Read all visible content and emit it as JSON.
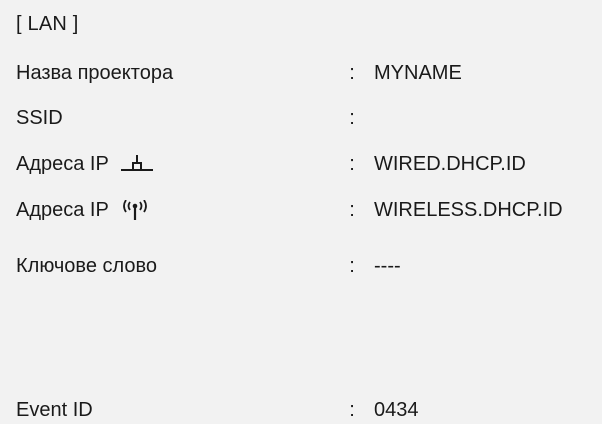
{
  "header": {
    "title": "[ LAN ]"
  },
  "rows": [
    {
      "label": "Назва проектора",
      "separator": ":",
      "value": "MYNAME"
    },
    {
      "label": "SSID",
      "separator": ":",
      "value": ""
    },
    {
      "label": "Адреса IP",
      "icon": "wired-lan-icon",
      "separator": ":",
      "value": "WIRED.DHCP.ID"
    },
    {
      "label": "Адреса IP",
      "icon": "wireless-antenna-icon",
      "separator": ":",
      "value": "WIRELESS.DHCP.ID"
    },
    {
      "label": "Ключове слово",
      "separator": ":",
      "value": "----"
    },
    {
      "label": "Event ID",
      "separator": ":",
      "value": "0434"
    }
  ],
  "colors": {
    "background": "#f2f2f2",
    "text": "#1a1a1a"
  }
}
